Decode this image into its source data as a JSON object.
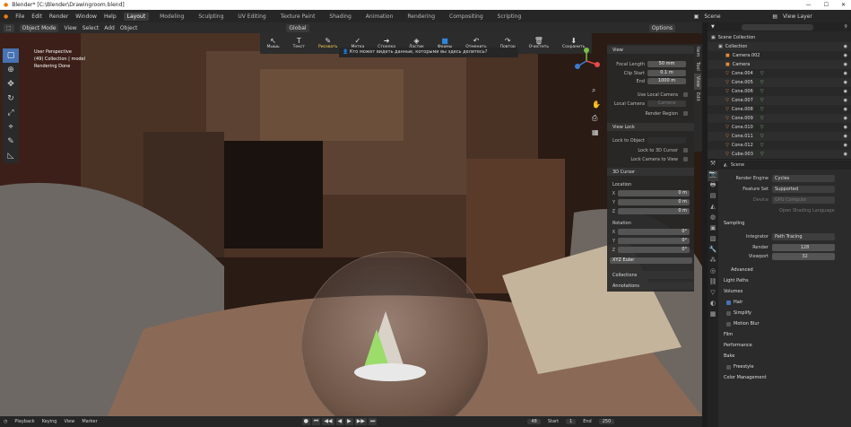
{
  "titlebar": {
    "text": "Blender* [C:\\Blender\\Drawingroom.blend]"
  },
  "menubar": {
    "menus": [
      "File",
      "Edit",
      "Render",
      "Window",
      "Help"
    ],
    "workspaces": [
      "Layout",
      "Modeling",
      "Sculpting",
      "UV Editing",
      "Texture Paint",
      "Shading",
      "Animation",
      "Rendering",
      "Compositing",
      "Scripting"
    ],
    "active_workspace": "Layout",
    "scene": "Scene",
    "view_layer": "View Layer"
  },
  "viewport": {
    "mode": "Object Mode",
    "header_menus": [
      "View",
      "Select",
      "Add",
      "Object"
    ],
    "orientation": "Global",
    "overlay_info": [
      "User Perspective",
      "(49) Collection | model",
      "Rendering Done"
    ],
    "options_label": "Options"
  },
  "ru_toolbar": {
    "items": [
      {
        "icon": "cursor-icon",
        "label": "Мышь"
      },
      {
        "icon": "text-icon",
        "label": "Текст"
      },
      {
        "icon": "draw-icon",
        "label": "Рисовать"
      },
      {
        "icon": "check-icon",
        "label": "Метка"
      },
      {
        "icon": "arrow-icon",
        "label": "Стрелка"
      },
      {
        "icon": "eraser-icon",
        "label": "Ластик"
      },
      {
        "icon": "shape-icon",
        "label": "Формы"
      },
      {
        "icon": "undo-icon",
        "label": "Отменить"
      },
      {
        "icon": "redo-icon",
        "label": "Повтор"
      },
      {
        "icon": "trash-icon",
        "label": "Очистить"
      },
      {
        "icon": "save-icon",
        "label": "Сохранить"
      }
    ],
    "question": "Кто может видеть данные, которыми вы здесь делитесь?"
  },
  "npanel": {
    "view_header": "View",
    "focal_length_label": "Focal Length",
    "focal_length": "50 mm",
    "clip_start_label": "Clip Start",
    "clip_start": "0.1 m",
    "end_label": "End",
    "end": "1000 m",
    "use_local_camera": "Use Local Camera",
    "local_camera_label": "Local Camera",
    "local_camera": "Camera",
    "render_region": "Render Region",
    "view_lock_header": "View Lock",
    "lock_to_object": "Lock to Object",
    "lock_to_3d_cursor": "Lock to 3D Cursor",
    "lock_camera_to_view": "Lock Camera to View",
    "cursor_header": "3D Cursor",
    "location_label": "Location",
    "loc": [
      {
        "axis": "X",
        "value": "0 m"
      },
      {
        "axis": "Y",
        "value": "0 m"
      },
      {
        "axis": "Z",
        "value": "0 m"
      }
    ],
    "rotation_label": "Rotation",
    "rot": [
      {
        "axis": "X",
        "value": "0°"
      },
      {
        "axis": "Y",
        "value": "0°"
      },
      {
        "axis": "Z",
        "value": "0°"
      }
    ],
    "rotation_mode": "XYZ Euler",
    "collections": "Collections",
    "annotations": "Annotations",
    "tabs": [
      "Item",
      "Tool",
      "View",
      "Edit"
    ]
  },
  "outliner": {
    "rows": [
      {
        "name": "Scene Collection",
        "type": "collection"
      },
      {
        "name": "Collection",
        "type": "collection"
      },
      {
        "name": "Camera.002",
        "type": "camera"
      },
      {
        "name": "Camera",
        "type": "camera"
      },
      {
        "name": "Cone.004",
        "type": "cone"
      },
      {
        "name": "Cone.005",
        "type": "cone"
      },
      {
        "name": "Cone.006",
        "type": "cone"
      },
      {
        "name": "Cone.007",
        "type": "cone"
      },
      {
        "name": "Cone.008",
        "type": "cone"
      },
      {
        "name": "Cone.009",
        "type": "cone"
      },
      {
        "name": "Cone.010",
        "type": "cone"
      },
      {
        "name": "Cone.011",
        "type": "cone"
      },
      {
        "name": "Cone.012",
        "type": "cone"
      },
      {
        "name": "Cube.003",
        "type": "cone"
      }
    ]
  },
  "properties": {
    "scene_label": "Scene",
    "render_engine_label": "Render Engine",
    "render_engine": "Cycles",
    "feature_set_label": "Feature Set",
    "feature_set": "Supported",
    "device_label": "Device",
    "device": "GPU Compute",
    "open_shading_language": "Open Shading Language",
    "sampling": "Sampling",
    "integrator_label": "Integrator",
    "integrator": "Path Tracing",
    "render_label": "Render",
    "render": "128",
    "viewport_label": "Viewport",
    "viewport": "32",
    "advanced": "Advanced",
    "sections": [
      "Light Paths",
      "Volumes",
      "Hair",
      "Simplify",
      "Motion Blur",
      "Film",
      "Performance",
      "Bake",
      "Freestyle",
      "Color Management"
    ]
  },
  "timeline": {
    "menus": [
      "Playback",
      "Keying",
      "View",
      "Marker"
    ],
    "current_frame": "48",
    "start_label": "Start",
    "start": "1",
    "end_label": "End",
    "end": "250"
  }
}
